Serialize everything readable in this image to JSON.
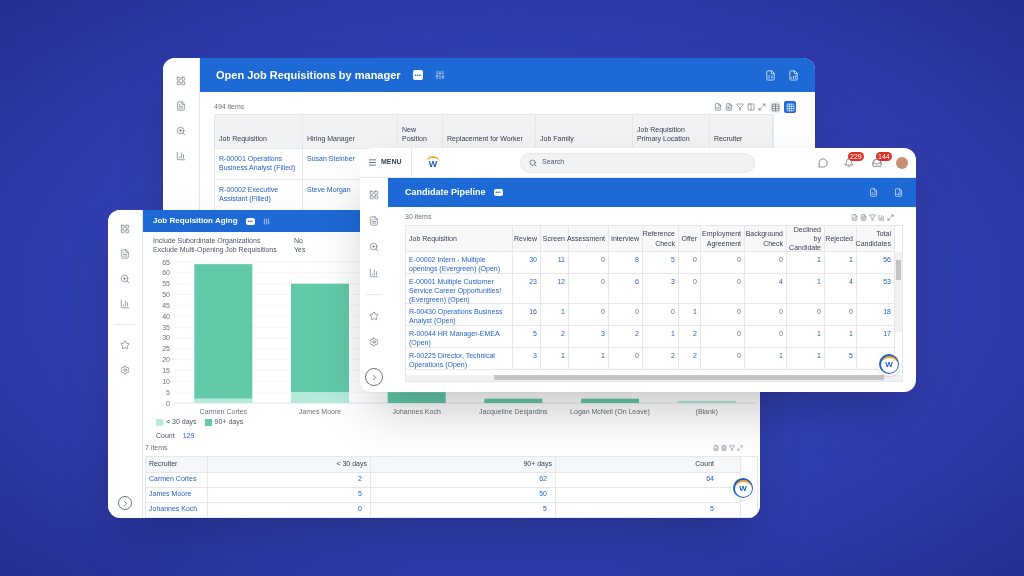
{
  "requisitions_window": {
    "title": "Open Job Requisitions by manager",
    "more": "•••",
    "item_count": "494 items",
    "views": [
      {
        "kind": "table",
        "selected": false
      },
      {
        "kind": "grid",
        "selected": true
      }
    ],
    "columns": [
      "Job Requisition",
      "Hiring Manager",
      "New Position",
      "Replacement for Worker",
      "Job Family",
      "Job Requisition Primary Location",
      "Recruiter"
    ],
    "rows": [
      [
        "R-00001 Operations Business Analyst (Filled)",
        "Susan Steinber"
      ],
      [
        "R-00002 Executive Assistant (Filled)",
        "Steve Morgan"
      ]
    ]
  },
  "aging_window": {
    "title": "Job Requisition Aging",
    "more": "•••",
    "filters": [
      {
        "label": "Include Subordinate Organizations",
        "value": "No"
      },
      {
        "label": "Exclude Multi-Opening Job Requisitions",
        "value": "Yes"
      }
    ],
    "chart_data": {
      "type": "bar",
      "stacked": true,
      "grid": true,
      "categories": [
        "Carmen Cortes",
        "James Moore",
        "Johannes Koch",
        "Jacqueline Desjardins",
        "Logan McNeil (On Leave)",
        "(Blank)"
      ],
      "series": [
        {
          "name": "< 30 days",
          "color": "#b5ebdc",
          "values": [
            2,
            5,
            0,
            0,
            0,
            1
          ]
        },
        {
          "name": "90+ days",
          "color": "#62c9a9",
          "values": [
            62,
            50,
            5,
            2,
            2,
            0
          ]
        }
      ],
      "ylim": [
        0,
        65
      ],
      "yticks": [
        0,
        5,
        10,
        15,
        20,
        25,
        30,
        35,
        40,
        45,
        50,
        55,
        60,
        65
      ]
    },
    "count_label": "Count",
    "count_value": "129",
    "item_count": "7 items",
    "columns": [
      "Recruiter",
      "< 30 days",
      "90+ days",
      "Count"
    ],
    "rows": [
      [
        "Carmen Cortes",
        "2",
        "62",
        "64"
      ],
      [
        "James Moore",
        "5",
        "50"
      ],
      [
        "Johannes Koch",
        "0",
        "5",
        "5"
      ]
    ],
    "chat_letter": "W"
  },
  "pipeline_window": {
    "menu": "MENU",
    "logo_letter": "W",
    "search_placeholder": "Search",
    "notifications": "229",
    "inbox": "144",
    "title": "Candidate Pipeline",
    "more": "•••",
    "item_count": "30 items",
    "columns": [
      "Job Requisition",
      "Review",
      "Screen",
      "Assessment",
      "Interview",
      "Reference Check",
      "Offer",
      "Employment Agreement",
      "Background Check",
      "Declined by Candidate",
      "Rejected",
      "Total Candidates"
    ],
    "rows": [
      [
        {
          "v": "E-00002 Intern - Multiple openings (Evergreen) (Open)",
          "link": true
        },
        {
          "v": "30",
          "link": true
        },
        {
          "v": "11",
          "link": true
        },
        {
          "v": "0",
          "link": false
        },
        {
          "v": "8",
          "link": true
        },
        {
          "v": "5",
          "link": true
        },
        {
          "v": "0",
          "link": false
        },
        {
          "v": "0",
          "link": false
        },
        {
          "v": "0",
          "link": false
        },
        {
          "v": "1",
          "link": true
        },
        {
          "v": "1",
          "link": true
        },
        {
          "v": "56",
          "link": true
        }
      ],
      [
        {
          "v": "E-00001 Multiple Customer Service Career Opportunities! (Evergreen) (Open)",
          "link": true
        },
        {
          "v": "23",
          "link": true
        },
        {
          "v": "12",
          "link": true
        },
        {
          "v": "0",
          "link": false
        },
        {
          "v": "6",
          "link": true
        },
        {
          "v": "3",
          "link": true
        },
        {
          "v": "0",
          "link": false
        },
        {
          "v": "0",
          "link": false
        },
        {
          "v": "4",
          "link": true
        },
        {
          "v": "1",
          "link": true
        },
        {
          "v": "4",
          "link": true
        },
        {
          "v": "53",
          "link": true
        }
      ],
      [
        {
          "v": "R-00430 Operations Business Analyst (Open)",
          "link": true
        },
        {
          "v": "16",
          "link": true
        },
        {
          "v": "1",
          "link": true
        },
        {
          "v": "0",
          "link": false
        },
        {
          "v": "0",
          "link": false
        },
        {
          "v": "0",
          "link": false
        },
        {
          "v": "1",
          "link": true
        },
        {
          "v": "0",
          "link": false
        },
        {
          "v": "0",
          "link": false
        },
        {
          "v": "0",
          "link": false
        },
        {
          "v": "0",
          "link": false
        },
        {
          "v": "18",
          "link": true
        }
      ],
      [
        {
          "v": "R-00044 HR Manager-EMEA (Open)",
          "link": true
        },
        {
          "v": "5",
          "link": true
        },
        {
          "v": "2",
          "link": true
        },
        {
          "v": "3",
          "link": true
        },
        {
          "v": "2",
          "link": true
        },
        {
          "v": "1",
          "link": true
        },
        {
          "v": "2",
          "link": true
        },
        {
          "v": "0",
          "link": false
        },
        {
          "v": "0",
          "link": false
        },
        {
          "v": "1",
          "link": true
        },
        {
          "v": "1",
          "link": true
        },
        {
          "v": "17",
          "link": true
        }
      ],
      [
        {
          "v": "R-00225 Director, Technical Operations (Open)",
          "link": true
        },
        {
          "v": "3",
          "link": true
        },
        {
          "v": "1",
          "link": true
        },
        {
          "v": "1",
          "link": true
        },
        {
          "v": "0",
          "link": false
        },
        {
          "v": "2",
          "link": true
        },
        {
          "v": "2",
          "link": true
        },
        {
          "v": "0",
          "link": false
        },
        {
          "v": "1",
          "link": true
        },
        {
          "v": "1",
          "link": true
        },
        {
          "v": "5",
          "link": true
        }
      ]
    ],
    "chat_letter": "W"
  }
}
